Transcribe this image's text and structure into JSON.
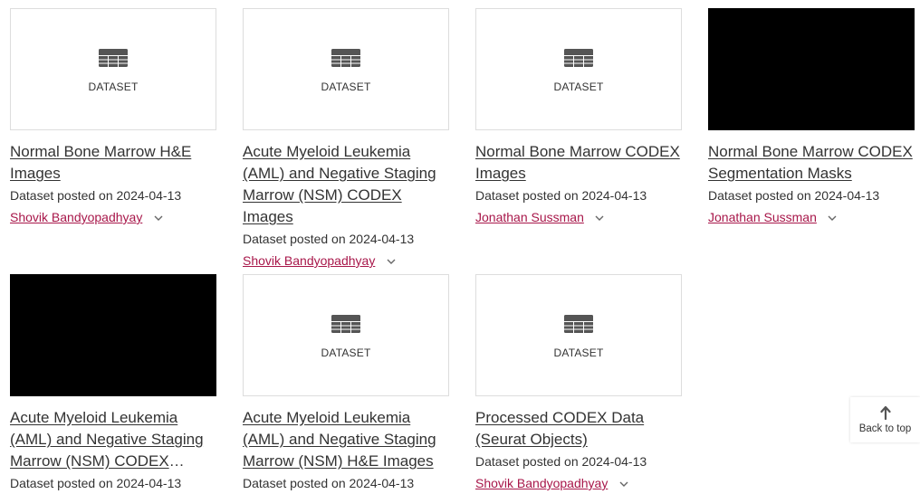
{
  "cards": [
    {
      "type": "DATASET",
      "title": "Normal Bone Marrow H&E Images",
      "posted": "Dataset posted on 2024-04-13",
      "author": "Shovik Bandyopadhyay",
      "thumb": "table"
    },
    {
      "type": "DATASET",
      "title": "Acute Myeloid Leukemia (AML) and Negative Staging Marrow (NSM) CODEX Images",
      "posted": "Dataset posted on 2024-04-13",
      "author": "Shovik Bandyopadhyay",
      "thumb": "table"
    },
    {
      "type": "DATASET",
      "title": "Normal Bone Marrow CODEX Images",
      "posted": "Dataset posted on 2024-04-13",
      "author": "Jonathan Sussman",
      "thumb": "table"
    },
    {
      "type": "",
      "title": "Normal Bone Marrow CODEX Segmentation Masks",
      "posted": "Dataset posted on 2024-04-13",
      "author": "Jonathan Sussman",
      "thumb": "black"
    },
    {
      "type": "",
      "title": "Acute Myeloid Leukemia (AML) and Negative Staging Marrow (NSM) CODEX Segmentatio…",
      "posted": "Dataset posted on 2024-04-13",
      "author": "",
      "thumb": "black"
    },
    {
      "type": "DATASET",
      "title": "Acute Myeloid Leukemia (AML) and Negative Staging Marrow (NSM) H&E Images",
      "posted": "Dataset posted on 2024-04-13",
      "author": "",
      "thumb": "table"
    },
    {
      "type": "DATASET",
      "title": "Processed CODEX Data (Seurat Objects)",
      "posted": "Dataset posted on 2024-04-13",
      "author": "Shovik Bandyopadhyay",
      "thumb": "table"
    }
  ],
  "back_to_top": "Back to top",
  "icons": {
    "thumb": "table-icon",
    "expand": "chevron-down-icon",
    "back": "arrow-up-icon"
  },
  "colors": {
    "author_link": "#a8174a",
    "text": "#333333",
    "border": "#dddddd"
  }
}
